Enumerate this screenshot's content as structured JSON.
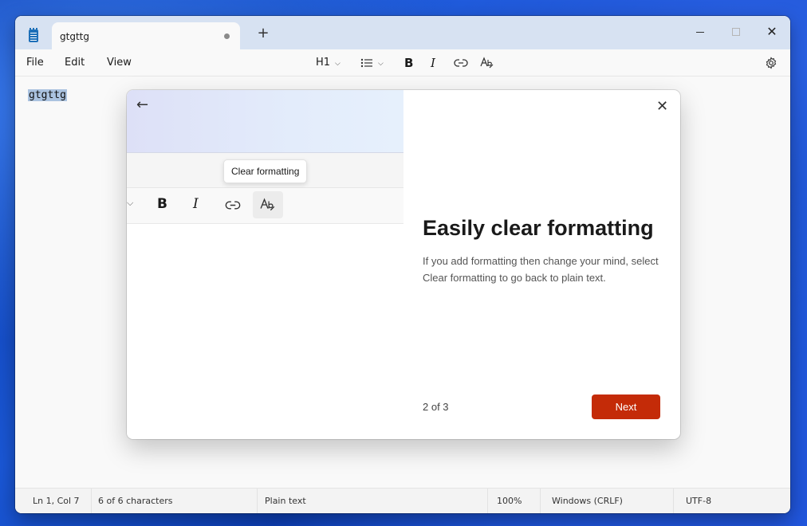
{
  "tab": {
    "title": "gtgttg"
  },
  "menu": {
    "file": "File",
    "edit": "Edit",
    "view": "View"
  },
  "toolbar": {
    "heading": "H1"
  },
  "editor": {
    "content": "gtgttg"
  },
  "dialog": {
    "tooltip": "Clear formatting",
    "title": "Easily clear formatting",
    "body": "If you add formatting then change your mind, select Clear formatting to go back to plain text.",
    "page_indicator": "2 of 3",
    "next_label": "Next"
  },
  "status": {
    "position": "Ln 1, Col 7",
    "characters": "6 of 6 characters",
    "format": "Plain text",
    "zoom": "100%",
    "line_endings": "Windows (CRLF)",
    "encoding": "UTF-8"
  },
  "colors": {
    "accent": "#c42b08",
    "selection": "#abc3e0",
    "titlebar": "#d7e2f2"
  }
}
